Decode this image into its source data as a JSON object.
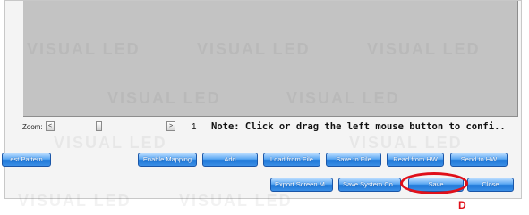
{
  "zoom": {
    "label": "Zoom:",
    "value": "1",
    "left_arrow": "<",
    "right_arrow": ">"
  },
  "note": "Note: Click or drag the left mouse button to confi..",
  "toolbar_row1": {
    "test_pattern": "est Pattern",
    "enable_mapping": "Enable Mapping",
    "add": "Add",
    "load_from_file": "Load from File",
    "save_to_file": "Save to File",
    "read_from_hw": "Read from HW",
    "send_to_hw": "Send to HW"
  },
  "toolbar_row2": {
    "export_screen": "Export Screen M..",
    "save_system_config": "Save System Co..",
    "save": "Save",
    "close": "Close"
  },
  "annotation": {
    "callout_letter": "D",
    "highlight_color": "#e0101a"
  },
  "watermark": "VISUAL LED"
}
